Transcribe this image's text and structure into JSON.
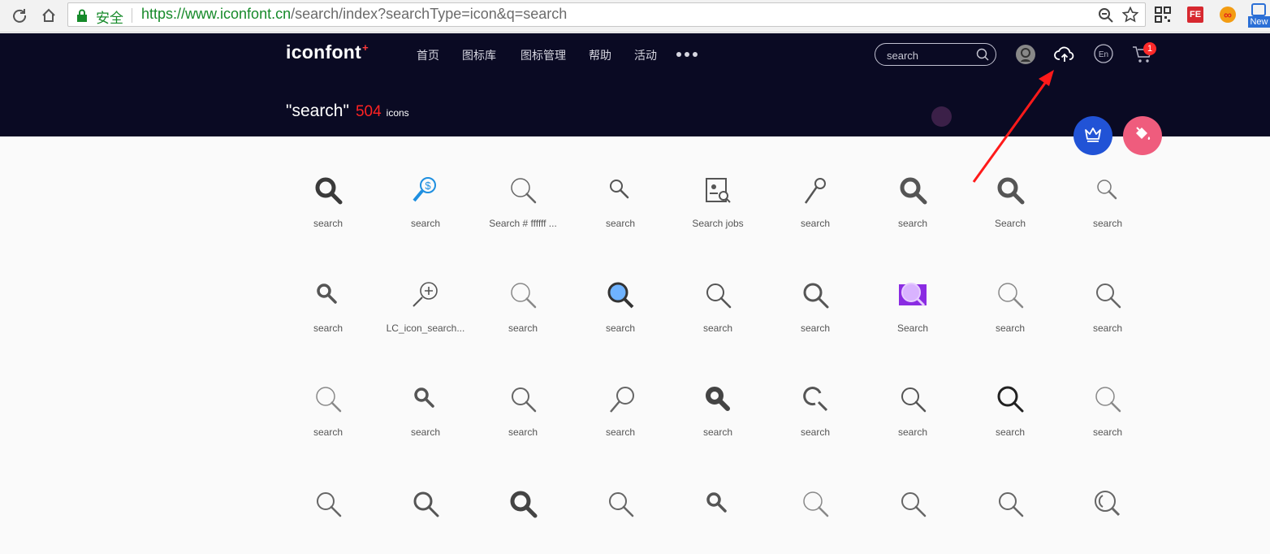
{
  "browser": {
    "secure_label": "安全",
    "url_scheme_host": "https://www.iconfont.cn",
    "url_path": "/search/index?searchType=icon&q=search",
    "ext_fe_label": "FE",
    "ext_new_label": "New"
  },
  "header": {
    "logo_text": "iconfont",
    "logo_mark": "+",
    "nav": [
      "首页",
      "图标库",
      "图标管理",
      "帮助",
      "活动"
    ],
    "search_placeholder": "search",
    "cart_count": "1",
    "lang_label": "En"
  },
  "result": {
    "query": "\"search\"",
    "count": "504",
    "unit": "icons"
  },
  "colors": {
    "header_bg": "#0a0a23",
    "accent_red": "#ff2222",
    "crown_blue": "#2153d6",
    "paint_pink": "#ef5c7d",
    "arrow_red": "#ff1a1a"
  },
  "icons": [
    {
      "label": "search",
      "style": "bold",
      "color": "#3a3a3a"
    },
    {
      "label": "search",
      "style": "dollar",
      "color": "#1e8fe0"
    },
    {
      "label": "Search # ffffff ...",
      "style": "thin",
      "color": "#666"
    },
    {
      "label": "search",
      "style": "small",
      "color": "#555"
    },
    {
      "label": "Search jobs",
      "style": "jobs",
      "color": "#555"
    },
    {
      "label": "search",
      "style": "lollipop",
      "color": "#555"
    },
    {
      "label": "search",
      "style": "bold",
      "color": "#555"
    },
    {
      "label": "Search",
      "style": "bold",
      "color": "#555"
    },
    {
      "label": "search",
      "style": "thin-small",
      "color": "#777"
    },
    {
      "label": "search",
      "style": "small-bold",
      "color": "#555"
    },
    {
      "label": "LC_icon_search...",
      "style": "plus",
      "color": "#555"
    },
    {
      "label": "search",
      "style": "thin",
      "color": "#888"
    },
    {
      "label": "search",
      "style": "blue-glass",
      "color": "#3a7bd5"
    },
    {
      "label": "search",
      "style": "regular",
      "color": "#555"
    },
    {
      "label": "search",
      "style": "regular-bold",
      "color": "#555"
    },
    {
      "label": "Search",
      "style": "purple",
      "color": "#8a2be2"
    },
    {
      "label": "search",
      "style": "thin",
      "color": "#888"
    },
    {
      "label": "search",
      "style": "regular",
      "color": "#666"
    },
    {
      "label": "search",
      "style": "thin",
      "color": "#888"
    },
    {
      "label": "search",
      "style": "small-bold",
      "color": "#555"
    },
    {
      "label": "search",
      "style": "regular",
      "color": "#666"
    },
    {
      "label": "search",
      "style": "lollipop-big",
      "color": "#666"
    },
    {
      "label": "search",
      "style": "dot",
      "color": "#444"
    },
    {
      "label": "search",
      "style": "open",
      "color": "#555"
    },
    {
      "label": "search",
      "style": "regular",
      "color": "#555"
    },
    {
      "label": "search",
      "style": "black",
      "color": "#222"
    },
    {
      "label": "search",
      "style": "thin",
      "color": "#888"
    },
    {
      "label": "",
      "style": "regular",
      "color": "#666"
    },
    {
      "label": "",
      "style": "regular-bold",
      "color": "#555"
    },
    {
      "label": "",
      "style": "bold",
      "color": "#444"
    },
    {
      "label": "",
      "style": "regular",
      "color": "#666"
    },
    {
      "label": "",
      "style": "small-bold",
      "color": "#555"
    },
    {
      "label": "",
      "style": "thin",
      "color": "#888"
    },
    {
      "label": "",
      "style": "regular",
      "color": "#666"
    },
    {
      "label": "",
      "style": "regular",
      "color": "#666"
    },
    {
      "label": "",
      "style": "ring",
      "color": "#666"
    }
  ]
}
